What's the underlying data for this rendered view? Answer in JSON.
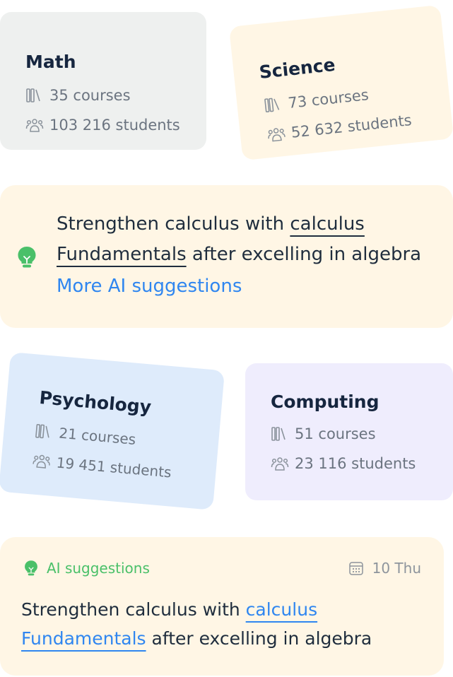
{
  "subjects": {
    "math": {
      "title": "Math",
      "courses": "35 courses",
      "students": "103 216 students",
      "color": "#eef0ef"
    },
    "science": {
      "title": "Science",
      "courses": "73 courses",
      "students": "52 632 students",
      "color": "#fff6e5"
    },
    "psychology": {
      "title": "Psychology",
      "courses": "21 courses",
      "students": "19 451 students",
      "color": "#deebfb"
    },
    "computing": {
      "title": "Computing",
      "courses": "51 courses",
      "students": "23 116 students",
      "color": "#efedfd"
    }
  },
  "suggestion_main": {
    "text_before": "Strengthen calculus with ",
    "link": "calculus Fundamentals",
    "text_after": " after excelling in algebra",
    "more_link": "More AI suggestions",
    "icon": "lightbulb-icon",
    "icon_color": "#4ac069"
  },
  "suggestion_panel": {
    "heading": "AI suggestions",
    "date": "10 Thu",
    "text_before": "Strengthen calculus with ",
    "link": "calculus Fundamentals",
    "text_after": " after excelling in algebra",
    "link_color": "#2f86f0"
  }
}
